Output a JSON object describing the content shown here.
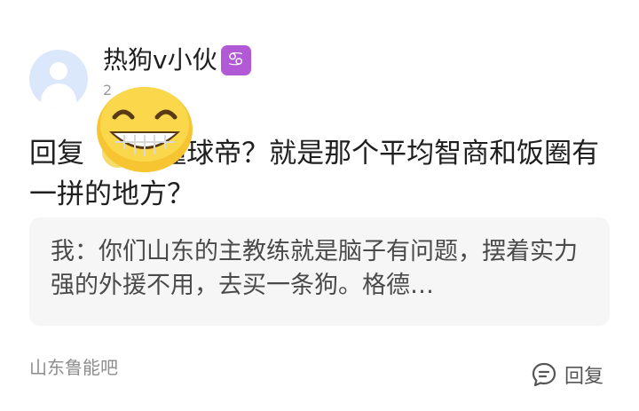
{
  "user": {
    "name": "热狗v小伙",
    "badge_icon": "cancer-zodiac-icon",
    "time": "2"
  },
  "reply": {
    "label": "回复",
    "target_visible": "",
    "text": ":懂球帝？就是那个平均智商和饭圈有一拼的地方？"
  },
  "quote": {
    "text": "我：你们山东的主教练就是脑子有问题，摆着实力强的外援不用，去买一条狗。格德…"
  },
  "forum": {
    "name": "山东鲁能吧"
  },
  "actions": {
    "reply_label": "回复"
  },
  "colors": {
    "zodiac": "#b259d6",
    "avatar_bg": "#dbe7fb",
    "quote_bg": "#f6f6f6"
  }
}
